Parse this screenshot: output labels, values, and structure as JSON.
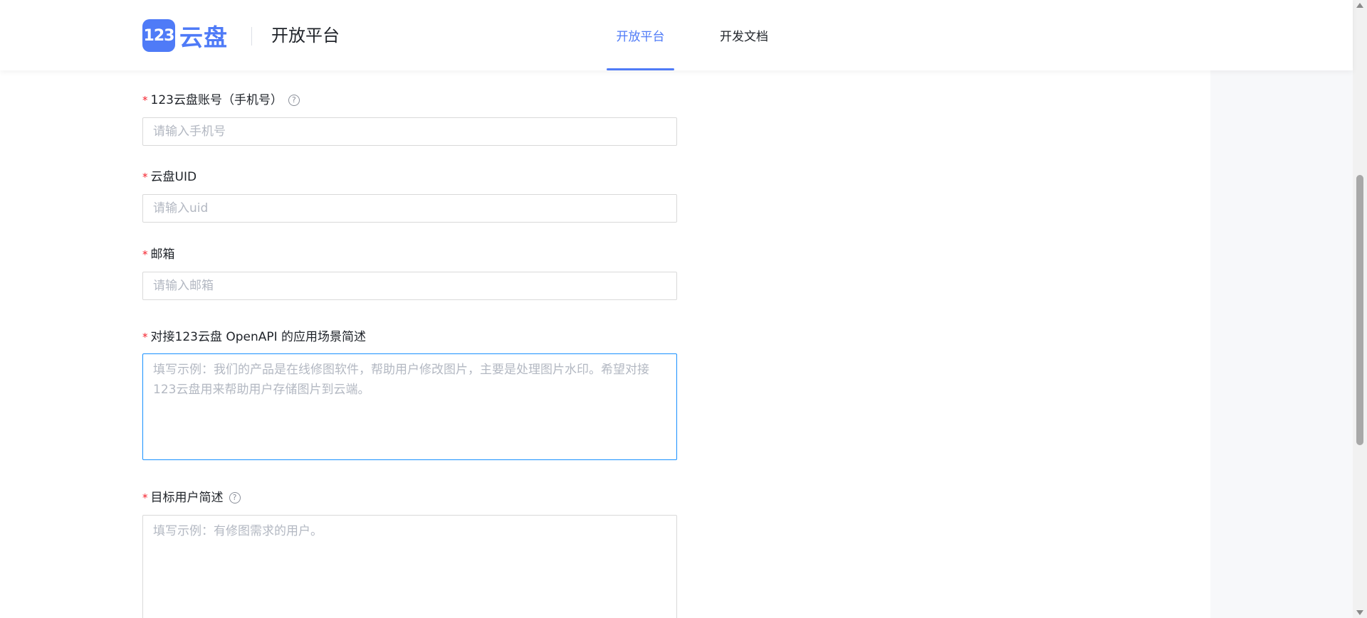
{
  "header": {
    "logo_badge": "123",
    "logo_text": "云盘",
    "platform_title": "开放平台",
    "tabs": [
      {
        "label": "开放平台",
        "active": true
      },
      {
        "label": "开发文档",
        "active": false
      }
    ]
  },
  "form": {
    "phone": {
      "label": "123云盘账号（手机号）",
      "placeholder": "请输入手机号",
      "required": true,
      "has_help": true
    },
    "uid": {
      "label": "云盘UID",
      "placeholder": "请输入uid",
      "required": true
    },
    "email": {
      "label": "邮箱",
      "placeholder": "请输入邮箱",
      "required": true
    },
    "scenario": {
      "label": "对接123云盘 OpenAPI 的应用场景简述",
      "placeholder": "填写示例：我们的产品是在线修图软件，帮助用户修改图片，主要是处理图片水印。希望对接123云盘用来帮助用户存储图片到云端。",
      "required": true
    },
    "target_users": {
      "label": "目标用户简述",
      "placeholder": "填写示例：有修图需求的用户。",
      "required": true,
      "has_help": true
    }
  },
  "ui": {
    "required_mark": "*",
    "help_glyph": "?"
  },
  "colors": {
    "brand": "#4f7bf7",
    "required": "#f5222d",
    "focus_border": "#1890ff",
    "placeholder": "#b3b8c2"
  },
  "icons": {
    "logo": "logo-123-icon",
    "help": "question-circle-icon",
    "scroll_up": "arrow-up-icon",
    "scroll_down": "arrow-down-icon"
  }
}
